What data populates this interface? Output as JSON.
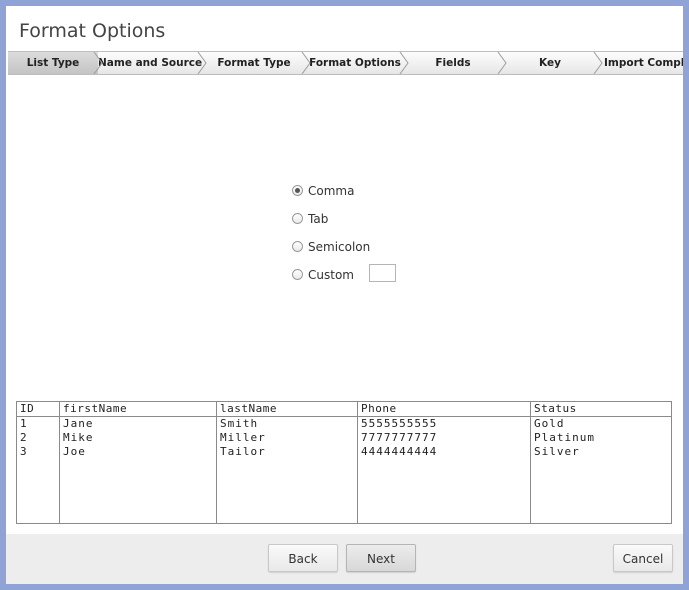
{
  "dialog": {
    "title": "Format Options"
  },
  "wizard": {
    "steps": [
      {
        "label": "List Type",
        "active": true
      },
      {
        "label": "Name and Source",
        "active": false
      },
      {
        "label": "Format Type",
        "active": false
      },
      {
        "label": "Format Options",
        "active": false
      },
      {
        "label": "Fields",
        "active": false
      },
      {
        "label": "Key",
        "active": false
      },
      {
        "label": "Import Complete",
        "active": false
      }
    ]
  },
  "delimiter": {
    "options": [
      {
        "label": "Comma",
        "checked": true
      },
      {
        "label": "Tab",
        "checked": false
      },
      {
        "label": "Semicolon",
        "checked": false
      },
      {
        "label": "Custom",
        "checked": false
      }
    ],
    "custom_value": ""
  },
  "preview": {
    "columns": [
      "ID",
      "firstName",
      "lastName",
      "Phone",
      "Status"
    ],
    "rows": [
      [
        "1",
        "Jane",
        "Smith",
        "5555555555",
        "Gold"
      ],
      [
        "2",
        "Mike",
        "Miller",
        "7777777777",
        "Platinum"
      ],
      [
        "3",
        "Joe",
        "Tailor",
        "4444444444",
        "Silver"
      ]
    ]
  },
  "footer": {
    "back_label": "Back",
    "next_label": "Next",
    "cancel_label": "Cancel"
  }
}
